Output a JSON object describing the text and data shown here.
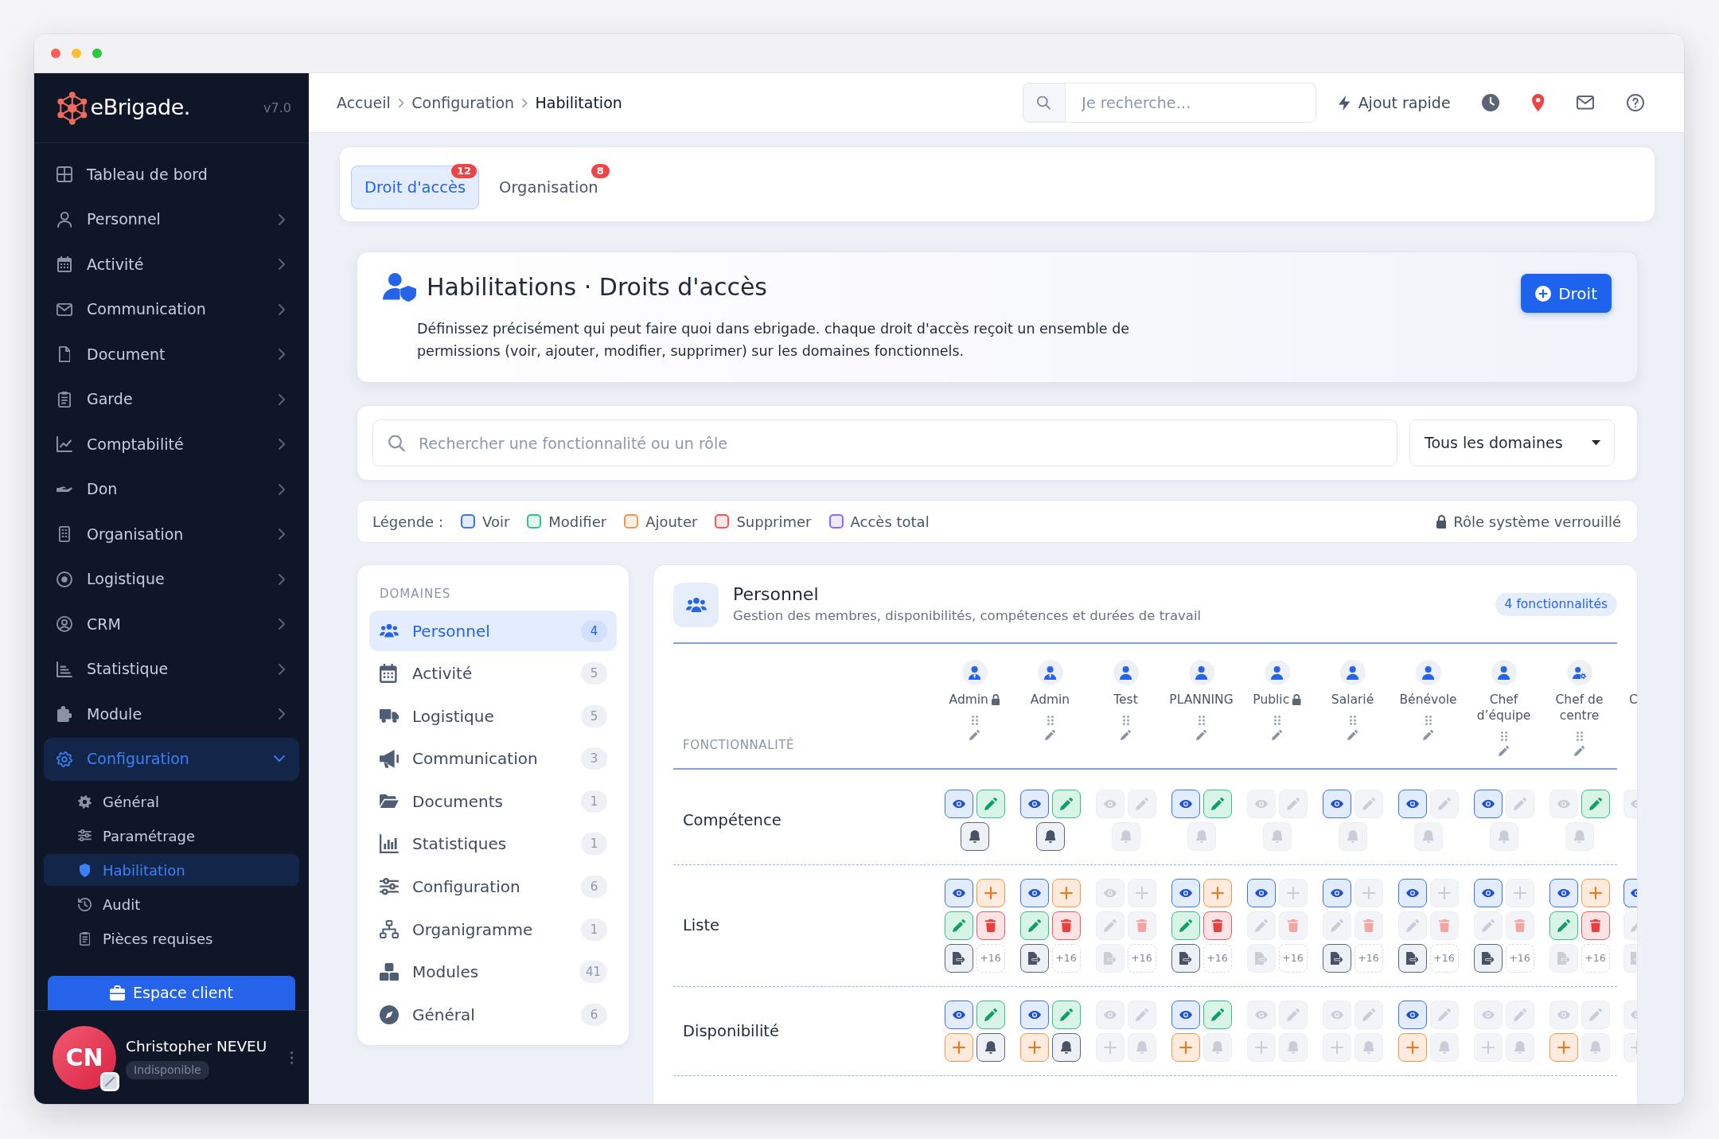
{
  "sidebar": {
    "brand": "eBrigade.",
    "version": "v7.0",
    "items": [
      {
        "label": "Tableau de bord",
        "selected": false,
        "expandable": false,
        "expanded": false
      },
      {
        "label": "Personnel",
        "selected": false,
        "expandable": true,
        "expanded": false
      },
      {
        "label": "Activité",
        "selected": false,
        "expandable": true,
        "expanded": false
      },
      {
        "label": "Communication",
        "selected": false,
        "expandable": true,
        "expanded": false
      },
      {
        "label": "Document",
        "selected": false,
        "expandable": true,
        "expanded": false
      },
      {
        "label": "Garde",
        "selected": false,
        "expandable": true,
        "expanded": false
      },
      {
        "label": "Comptabilité",
        "selected": false,
        "expandable": true,
        "expanded": false
      },
      {
        "label": "Don",
        "selected": false,
        "expandable": true,
        "expanded": false
      },
      {
        "label": "Organisation",
        "selected": false,
        "expandable": true,
        "expanded": false
      },
      {
        "label": "Logistique",
        "selected": false,
        "expandable": true,
        "expanded": false
      },
      {
        "label": "CRM",
        "selected": false,
        "expandable": true,
        "expanded": false
      },
      {
        "label": "Statistique",
        "selected": false,
        "expandable": true,
        "expanded": false
      },
      {
        "label": "Module",
        "selected": false,
        "expandable": true,
        "expanded": false
      },
      {
        "label": "Configuration",
        "selected": true,
        "expandable": true,
        "expanded": true,
        "children": [
          {
            "label": "Général",
            "selected": false
          },
          {
            "label": "Paramétrage",
            "selected": false
          },
          {
            "label": "Habilitation",
            "selected": true
          },
          {
            "label": "Audit",
            "selected": false
          },
          {
            "label": "Pièces requises",
            "selected": false
          }
        ]
      }
    ],
    "button": "Espace client",
    "user": {
      "initials": "CN",
      "name": "Christopher NEVEU",
      "status": "Indisponible"
    }
  },
  "topbar": {
    "breadcrumb": [
      "Accueil",
      "Configuration",
      "Habilitation"
    ],
    "search": {
      "placeholder": "Je recherche…"
    },
    "quick_add": "Ajout rapide"
  },
  "tabs": [
    {
      "label": "Droit d'accès",
      "badge": "12",
      "selected": true
    },
    {
      "label": "Organisation",
      "badge": "8",
      "selected": false
    }
  ],
  "header": {
    "title": "Habilitations · Droits d'accès",
    "description": "Définissez précisément qui peut faire quoi dans ebrigade. chaque droit d'accès reçoit un ensemble de permissions (voir, ajouter, modifier, supprimer) sur les domaines fonctionnels.",
    "button": "Droit"
  },
  "filters": {
    "search": {
      "placeholder": "Rechercher une fonctionnalité ou un rôle"
    },
    "domain": {
      "value": "Tous les domaines"
    }
  },
  "legend": {
    "label": "Légende :",
    "items": [
      {
        "label": "Voir",
        "color": "#3b73ec"
      },
      {
        "label": "Modifier",
        "color": "#34c08a"
      },
      {
        "label": "Ajouter",
        "color": "#f69550"
      },
      {
        "label": "Supprimer",
        "color": "#ee5a5a"
      },
      {
        "label": "Accès total",
        "color": "#8b6cf0"
      }
    ],
    "note": "Rôle système verrouillé"
  },
  "domains": {
    "title": "DOMAINES",
    "items": [
      {
        "label": "Personnel",
        "count": "4",
        "selected": true
      },
      {
        "label": "Activité",
        "count": "5",
        "selected": false
      },
      {
        "label": "Logistique",
        "count": "5",
        "selected": false
      },
      {
        "label": "Communication",
        "count": "3",
        "selected": false
      },
      {
        "label": "Documents",
        "count": "1",
        "selected": false
      },
      {
        "label": "Statistiques",
        "count": "1",
        "selected": false
      },
      {
        "label": "Configuration",
        "count": "6",
        "selected": false
      },
      {
        "label": "Organigramme",
        "count": "1",
        "selected": false
      },
      {
        "label": "Modules",
        "count": "41",
        "selected": false
      },
      {
        "label": "Général",
        "count": "6",
        "selected": false
      }
    ]
  },
  "matrix": {
    "title": "Personnel",
    "subtitle": "Gestion des membres, disponibilités, compétences et durées de travail",
    "count": "4 fonctionnalités",
    "column_header": "FONCTIONNALITÉ",
    "roles": [
      {
        "name": "Admin",
        "kind": "admin",
        "locked": true
      },
      {
        "name": "Admin",
        "kind": "admin",
        "locked": false
      },
      {
        "name": "Test",
        "kind": "user",
        "locked": false
      },
      {
        "name": "PLANNING",
        "kind": "user",
        "locked": false
      },
      {
        "name": "Public",
        "kind": "user",
        "locked": true
      },
      {
        "name": "Salarié",
        "kind": "user",
        "locked": false
      },
      {
        "name": "Bénévole",
        "kind": "user",
        "locked": false
      },
      {
        "name": "Chef d’équipe",
        "kind": "user",
        "locked": false
      },
      {
        "name": "Chef de centre",
        "kind": "manager",
        "locked": false
      },
      {
        "name": "C",
        "kind": "cut",
        "locked": false
      }
    ],
    "rows": [
      {
        "name": "Compétence",
        "cells": [
          [
            {
              "kind": "view",
              "on": true
            },
            {
              "kind": "edit",
              "on": true
            },
            {
              "kind": "notify",
              "on": true
            }
          ],
          [
            {
              "kind": "view",
              "on": true
            },
            {
              "kind": "edit",
              "on": true
            },
            {
              "kind": "notify",
              "on": true
            }
          ],
          [
            {
              "kind": "view",
              "on": false
            },
            {
              "kind": "edit",
              "on": false
            },
            {
              "kind": "notify",
              "on": false
            }
          ],
          [
            {
              "kind": "view",
              "on": true
            },
            {
              "kind": "edit",
              "on": true
            },
            {
              "kind": "notify",
              "on": false
            }
          ],
          [
            {
              "kind": "view",
              "on": false
            },
            {
              "kind": "edit",
              "on": false
            },
            {
              "kind": "notify",
              "on": false
            }
          ],
          [
            {
              "kind": "view",
              "on": true
            },
            {
              "kind": "edit",
              "on": false
            },
            {
              "kind": "notify",
              "on": false
            }
          ],
          [
            {
              "kind": "view",
              "on": true
            },
            {
              "kind": "edit",
              "on": false
            },
            {
              "kind": "notify",
              "on": false
            }
          ],
          [
            {
              "kind": "view",
              "on": true
            },
            {
              "kind": "edit",
              "on": false
            },
            {
              "kind": "notify",
              "on": false
            }
          ],
          [
            {
              "kind": "view",
              "on": false
            },
            {
              "kind": "edit",
              "on": true
            },
            {
              "kind": "notify",
              "on": false
            }
          ],
          [
            {
              "kind": "view",
              "on": false
            }
          ]
        ]
      },
      {
        "name": "Liste",
        "cells": [
          [
            {
              "kind": "view",
              "on": true
            },
            {
              "kind": "add",
              "on": true
            },
            {
              "kind": "edit",
              "on": true
            },
            {
              "kind": "delete",
              "on": true
            },
            {
              "kind": "export",
              "on": true
            },
            {
              "kind": "more",
              "text": "+16"
            }
          ],
          [
            {
              "kind": "view",
              "on": true
            },
            {
              "kind": "add",
              "on": true
            },
            {
              "kind": "edit",
              "on": true
            },
            {
              "kind": "delete",
              "on": true
            },
            {
              "kind": "export",
              "on": true
            },
            {
              "kind": "more",
              "text": "+16"
            }
          ],
          [
            {
              "kind": "view",
              "on": false
            },
            {
              "kind": "add",
              "on": false
            },
            {
              "kind": "edit",
              "on": false
            },
            {
              "kind": "delete",
              "on": false
            },
            {
              "kind": "export",
              "on": false
            },
            {
              "kind": "more",
              "text": "+16"
            }
          ],
          [
            {
              "kind": "view",
              "on": true
            },
            {
              "kind": "add",
              "on": true
            },
            {
              "kind": "edit",
              "on": true
            },
            {
              "kind": "delete",
              "on": true
            },
            {
              "kind": "export",
              "on": true
            },
            {
              "kind": "more",
              "text": "+16"
            }
          ],
          [
            {
              "kind": "view",
              "on": true
            },
            {
              "kind": "add",
              "on": false
            },
            {
              "kind": "edit",
              "on": false
            },
            {
              "kind": "delete",
              "on": false
            },
            {
              "kind": "export",
              "on": false
            },
            {
              "kind": "more",
              "text": "+16"
            }
          ],
          [
            {
              "kind": "view",
              "on": true
            },
            {
              "kind": "add",
              "on": false
            },
            {
              "kind": "edit",
              "on": false
            },
            {
              "kind": "delete",
              "on": false
            },
            {
              "kind": "export",
              "on": true
            },
            {
              "kind": "more",
              "text": "+16"
            }
          ],
          [
            {
              "kind": "view",
              "on": true
            },
            {
              "kind": "add",
              "on": false
            },
            {
              "kind": "edit",
              "on": false
            },
            {
              "kind": "delete",
              "on": false
            },
            {
              "kind": "export",
              "on": true
            },
            {
              "kind": "more",
              "text": "+16"
            }
          ],
          [
            {
              "kind": "view",
              "on": true
            },
            {
              "kind": "add",
              "on": false
            },
            {
              "kind": "edit",
              "on": false
            },
            {
              "kind": "delete",
              "on": false
            },
            {
              "kind": "export",
              "on": true
            },
            {
              "kind": "more",
              "text": "+16"
            }
          ],
          [
            {
              "kind": "view",
              "on": true
            },
            {
              "kind": "add",
              "on": true
            },
            {
              "kind": "edit",
              "on": true
            },
            {
              "kind": "delete",
              "on": true
            },
            {
              "kind": "export",
              "on": false
            },
            {
              "kind": "more",
              "text": "+16"
            }
          ],
          [
            {
              "kind": "view",
              "on": true
            },
            {
              "kind": "edit",
              "on": false
            },
            {
              "kind": "export",
              "on": false
            }
          ]
        ]
      },
      {
        "name": "Disponibilité",
        "cells": [
          [
            {
              "kind": "view",
              "on": true
            },
            {
              "kind": "edit",
              "on": true
            },
            {
              "kind": "add",
              "on": true
            },
            {
              "kind": "notify",
              "on": true
            }
          ],
          [
            {
              "kind": "view",
              "on": true
            },
            {
              "kind": "edit",
              "on": true
            },
            {
              "kind": "add",
              "on": true
            },
            {
              "kind": "notify",
              "on": true
            }
          ],
          [
            {
              "kind": "view",
              "on": false
            },
            {
              "kind": "edit",
              "on": false
            },
            {
              "kind": "add",
              "on": false
            },
            {
              "kind": "notify",
              "on": false
            }
          ],
          [
            {
              "kind": "view",
              "on": true
            },
            {
              "kind": "edit",
              "on": true
            },
            {
              "kind": "add",
              "on": true
            },
            {
              "kind": "notify",
              "on": false
            }
          ],
          [
            {
              "kind": "view",
              "on": false
            },
            {
              "kind": "edit",
              "on": false
            },
            {
              "kind": "add",
              "on": false
            },
            {
              "kind": "notify",
              "on": false
            }
          ],
          [
            {
              "kind": "view",
              "on": false
            },
            {
              "kind": "edit",
              "on": false
            },
            {
              "kind": "add",
              "on": false
            },
            {
              "kind": "notify",
              "on": false
            }
          ],
          [
            {
              "kind": "view",
              "on": true
            },
            {
              "kind": "edit",
              "on": false
            },
            {
              "kind": "add",
              "on": true
            },
            {
              "kind": "notify",
              "on": false
            }
          ],
          [
            {
              "kind": "view",
              "on": false
            },
            {
              "kind": "edit",
              "on": false
            },
            {
              "kind": "add",
              "on": false
            },
            {
              "kind": "notify",
              "on": false
            }
          ],
          [
            {
              "kind": "view",
              "on": false
            },
            {
              "kind": "edit",
              "on": false
            },
            {
              "kind": "add",
              "on": true
            },
            {
              "kind": "notify",
              "on": false
            }
          ],
          [
            {
              "kind": "view",
              "on": false
            },
            {
              "kind": "add",
              "on": false
            }
          ]
        ]
      }
    ]
  }
}
